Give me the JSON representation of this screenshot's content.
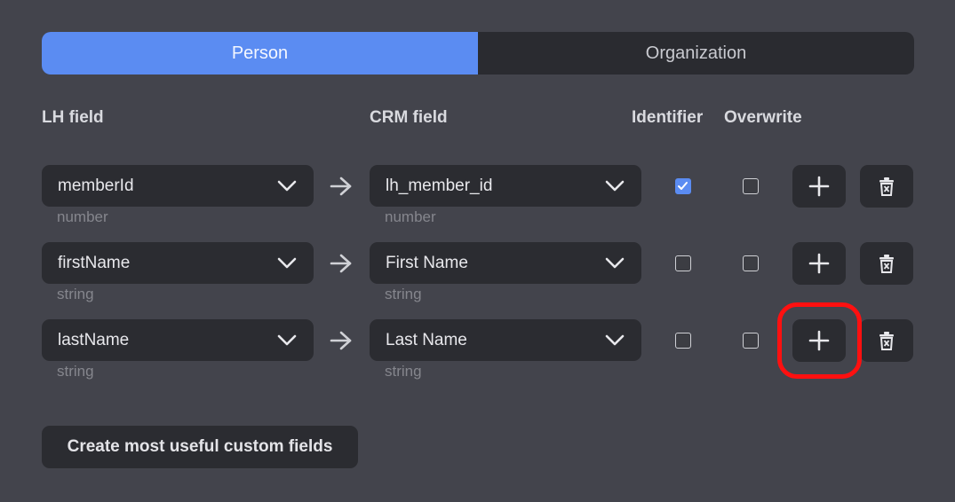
{
  "tabs": {
    "person": "Person",
    "organization": "Organization"
  },
  "headers": {
    "lh_field": "LH field",
    "crm_field": "CRM field",
    "identifier": "Identifier",
    "overwrite": "Overwrite"
  },
  "rows": [
    {
      "lh_field": "memberId",
      "lh_type": "number",
      "crm_field": "lh_member_id",
      "crm_type": "number",
      "identifier": true,
      "overwrite": false
    },
    {
      "lh_field": "firstName",
      "lh_type": "string",
      "crm_field": "First Name",
      "crm_type": "string",
      "identifier": false,
      "overwrite": false
    },
    {
      "lh_field": "lastName",
      "lh_type": "string",
      "crm_field": "Last Name",
      "crm_type": "string",
      "identifier": false,
      "overwrite": false
    }
  ],
  "create_button": "Create most useful custom fields",
  "colors": {
    "accent": "#5b8cf2",
    "highlight": "#ff1010",
    "background": "#43444c",
    "control": "#2b2c31"
  },
  "icons": {
    "dropdown": "chevron-down-icon",
    "mapping": "arrow-right-icon",
    "add": "plus-icon",
    "delete": "trash-icon",
    "check": "check-icon"
  }
}
